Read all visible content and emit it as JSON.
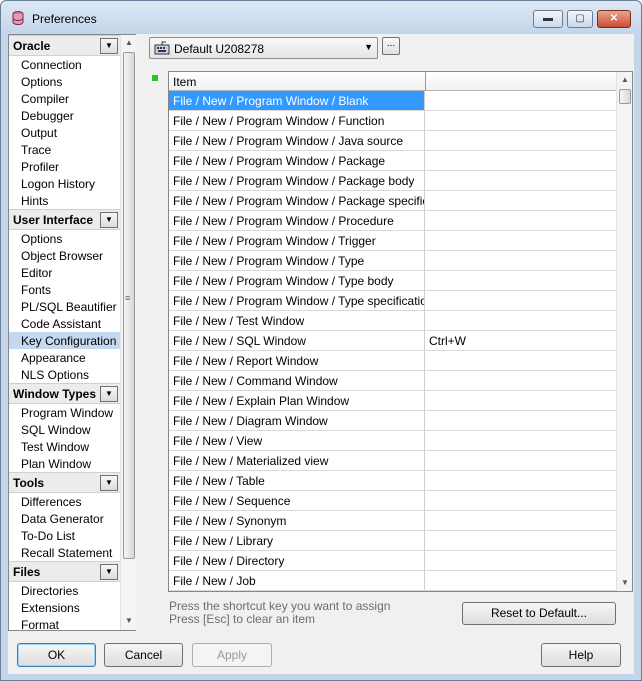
{
  "window": {
    "title": "Preferences",
    "minimize": "▬",
    "maximize": "▢",
    "close": "✕"
  },
  "sidebar": {
    "groups": [
      {
        "label": "Oracle",
        "items": [
          "Connection",
          "Options",
          "Compiler",
          "Debugger",
          "Output",
          "Trace",
          "Profiler",
          "Logon History",
          "Hints"
        ]
      },
      {
        "label": "User Interface",
        "items": [
          "Options",
          "Object Browser",
          "Editor",
          "Fonts",
          "PL/SQL Beautifier",
          "Code Assistant",
          "Key Configuration",
          "Appearance",
          "NLS Options"
        ]
      },
      {
        "label": "Window Types",
        "items": [
          "Program Window",
          "SQL Window",
          "Test Window",
          "Plan Window"
        ]
      },
      {
        "label": "Tools",
        "items": [
          "Differences",
          "Data Generator",
          "To-Do List",
          "Recall Statement"
        ]
      },
      {
        "label": "Files",
        "items": [
          "Directories",
          "Extensions",
          "Format"
        ]
      }
    ],
    "selected": "Key Configuration"
  },
  "profile": {
    "value": "Default U208278",
    "more": "..."
  },
  "table": {
    "header": "Item",
    "rows": [
      {
        "item": "File / New / Program Window / Blank",
        "key": "",
        "selected": true
      },
      {
        "item": "File / New / Program Window / Function",
        "key": ""
      },
      {
        "item": "File / New / Program Window / Java source",
        "key": ""
      },
      {
        "item": "File / New / Program Window / Package",
        "key": ""
      },
      {
        "item": "File / New / Program Window / Package body",
        "key": ""
      },
      {
        "item": "File / New / Program Window / Package specification",
        "key": ""
      },
      {
        "item": "File / New / Program Window / Procedure",
        "key": ""
      },
      {
        "item": "File / New / Program Window / Trigger",
        "key": ""
      },
      {
        "item": "File / New / Program Window / Type",
        "key": ""
      },
      {
        "item": "File / New / Program Window / Type body",
        "key": ""
      },
      {
        "item": "File / New / Program Window / Type specification",
        "key": ""
      },
      {
        "item": "File / New / Test Window",
        "key": ""
      },
      {
        "item": "File / New / SQL Window",
        "key": "Ctrl+W"
      },
      {
        "item": "File / New / Report Window",
        "key": ""
      },
      {
        "item": "File / New / Command Window",
        "key": ""
      },
      {
        "item": "File / New / Explain Plan Window",
        "key": ""
      },
      {
        "item": "File / New / Diagram Window",
        "key": ""
      },
      {
        "item": "File / New / View",
        "key": ""
      },
      {
        "item": "File / New / Materialized view",
        "key": ""
      },
      {
        "item": "File / New / Table",
        "key": ""
      },
      {
        "item": "File / New / Sequence",
        "key": ""
      },
      {
        "item": "File / New / Synonym",
        "key": ""
      },
      {
        "item": "File / New / Library",
        "key": ""
      },
      {
        "item": "File / New / Directory",
        "key": ""
      },
      {
        "item": "File / New / Job",
        "key": ""
      }
    ]
  },
  "hint": {
    "line1": "Press the shortcut key you want to assign",
    "line2": "Press [Esc] to clear an item"
  },
  "buttons": {
    "reset": "Reset to Default...",
    "ok": "OK",
    "cancel": "Cancel",
    "apply": "Apply",
    "help": "Help"
  },
  "icons": {
    "dropdown": "▼",
    "scroll_up": "▲",
    "scroll_down": "▼",
    "grip": "≡"
  },
  "colors": {
    "selection": "#3399ff",
    "sidebar_selection": "#c4d8ef",
    "indicator": "#2bc22b"
  }
}
